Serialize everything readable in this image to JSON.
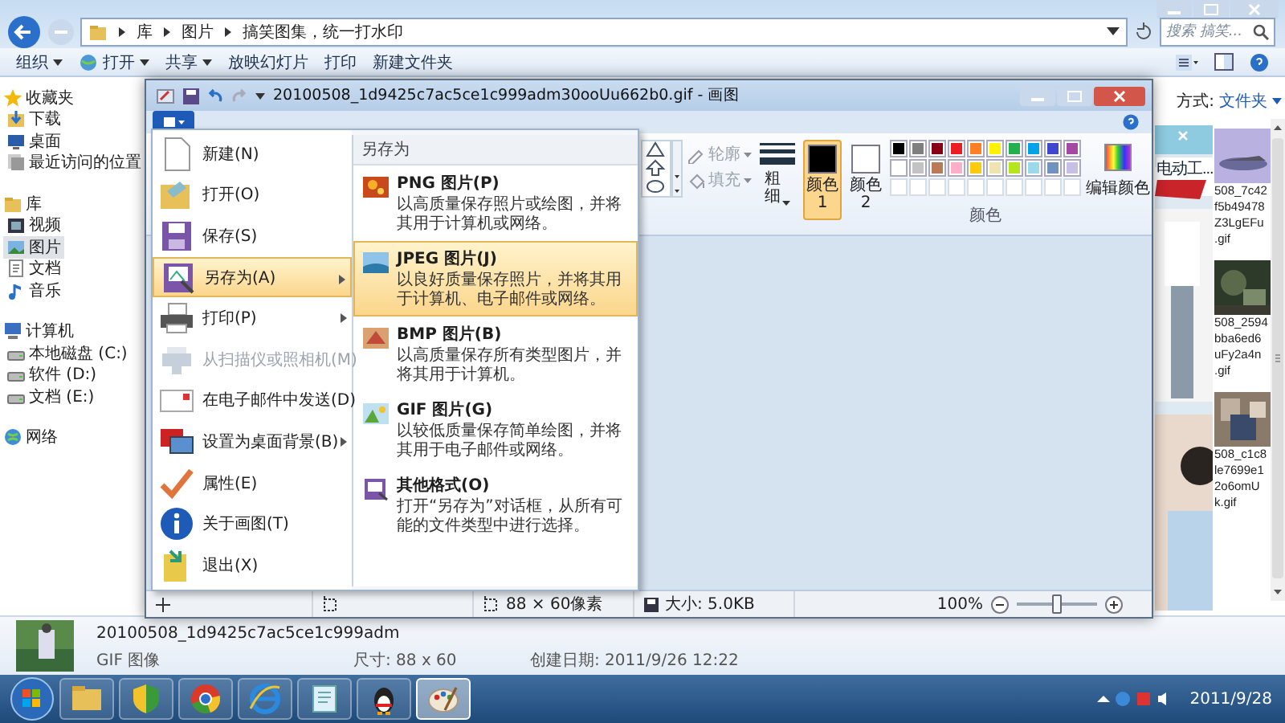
{
  "explorer": {
    "breadcrumb": [
      "库",
      "图片",
      "搞笑图集，统一打水印"
    ],
    "search": {
      "placeholder": "搜索 搞笑..."
    },
    "toolbar": [
      {
        "label": "组织",
        "dropdown": true,
        "kind": "plain"
      },
      {
        "label": "打开",
        "dropdown": true,
        "kind": "app"
      },
      {
        "label": "共享",
        "dropdown": true,
        "kind": "plain"
      },
      {
        "label": "放映幻灯片",
        "dropdown": false,
        "kind": "plain"
      },
      {
        "label": "打印",
        "dropdown": false,
        "kind": "plain"
      },
      {
        "label": "新建文件夹",
        "dropdown": false,
        "kind": "plain"
      }
    ],
    "sidebar": [
      {
        "label": "收藏夹",
        "kind": "star",
        "children": [
          {
            "label": "下载",
            "kind": "download",
            "selected": false
          },
          {
            "label": "桌面",
            "kind": "desktop",
            "selected": false
          },
          {
            "label": "最近访问的位置",
            "kind": "recent",
            "selected": false
          }
        ]
      },
      {
        "label": "库",
        "kind": "library",
        "children": [
          {
            "label": "视频",
            "kind": "video",
            "selected": false
          },
          {
            "label": "图片",
            "kind": "picture",
            "selected": true
          },
          {
            "label": "文档",
            "kind": "doc",
            "selected": false
          },
          {
            "label": "音乐",
            "kind": "music",
            "selected": false
          }
        ]
      },
      {
        "label": "计算机",
        "kind": "computer",
        "children": [
          {
            "label": "本地磁盘 (C:)",
            "kind": "drive",
            "selected": false
          },
          {
            "label": "软件 (D:)",
            "kind": "drive",
            "selected": false
          },
          {
            "label": "文档 (E:)",
            "kind": "drive",
            "selected": false
          }
        ]
      },
      {
        "label": "网络",
        "kind": "network"
      }
    ],
    "arrange": {
      "label": "方式:",
      "value": "文件夹"
    },
    "ad": {
      "text": "电动工..."
    },
    "thumbnails": [
      {
        "lines": [
          "508_7c42",
          "f5b49478",
          "Z3LgEFu",
          ".gif"
        ]
      },
      {
        "lines": [
          "508_2594",
          "bba6ed6",
          "uFy2a4n",
          ".gif"
        ]
      },
      {
        "lines": [
          "508_c1c8",
          "le7699e1",
          "2o6omU",
          "k.gif"
        ]
      }
    ],
    "details": {
      "name": "20100508_1d9425c7ac5ce1c999adm",
      "type": "GIF 图像",
      "size": "尺寸: 88 x 60",
      "created": "创建日期: 2011/9/26 12:22"
    }
  },
  "paint": {
    "title": "20100508_1d9425c7ac5ce1c999adm30ooUu662b0.gif - 画图",
    "menu": [
      {
        "label": "新建(N)",
        "kind": "new",
        "submenu": false,
        "disabled": false,
        "selected": false
      },
      {
        "label": "打开(O)",
        "kind": "open",
        "submenu": false,
        "disabled": false,
        "selected": false
      },
      {
        "label": "保存(S)",
        "kind": "save",
        "submenu": false,
        "disabled": false,
        "selected": false
      },
      {
        "label": "另存为(A)",
        "kind": "saveas",
        "submenu": true,
        "disabled": false,
        "selected": true
      },
      {
        "label": "打印(P)",
        "kind": "print",
        "submenu": true,
        "disabled": false,
        "selected": false
      },
      {
        "label": "从扫描仪或照相机(M)",
        "kind": "scanner",
        "submenu": false,
        "disabled": true,
        "selected": false
      },
      {
        "label": "在电子邮件中发送(D)",
        "kind": "email",
        "submenu": false,
        "disabled": false,
        "selected": false
      },
      {
        "label": "设置为桌面背景(B)",
        "kind": "wallpaper",
        "submenu": true,
        "disabled": false,
        "selected": false
      },
      {
        "label": "属性(E)",
        "kind": "check",
        "submenu": false,
        "disabled": false,
        "selected": false
      },
      {
        "label": "关于画图(T)",
        "kind": "info",
        "submenu": false,
        "disabled": false,
        "selected": false
      },
      {
        "label": "退出(X)",
        "kind": "exit",
        "submenu": false,
        "disabled": false,
        "selected": false
      }
    ],
    "save_as": {
      "heading": "另存为",
      "items": [
        {
          "title": "PNG 图片(P)",
          "text": "以高质量保存照片或绘图，并将其用于计算机或网络。",
          "kind": "flowers",
          "selected": false
        },
        {
          "title": "JPEG 图片(J)",
          "text": "以良好质量保存照片，并将其用于计算机、电子邮件或网络。",
          "kind": "landscape",
          "selected": true
        },
        {
          "title": "BMP 图片(B)",
          "text": "以高质量保存所有类型图片，并将其用于计算机。",
          "kind": "painting",
          "selected": false
        },
        {
          "title": "GIF 图片(G)",
          "text": "以较低质量保存简单绘图，并将其用于电子邮件或网络。",
          "kind": "drawing",
          "selected": false
        },
        {
          "title": "其他格式(O)",
          "text": "打开“另存为”对话框，从所有可能的文件类型中进行选择。",
          "kind": "other",
          "selected": false
        }
      ]
    },
    "ribbon": {
      "outline": {
        "label": "轮廓",
        "disabled": true
      },
      "fill": {
        "label": "填充",
        "disabled": true
      },
      "size": {
        "label": "粗细"
      },
      "colors": [
        {
          "label": "颜色 1",
          "color": "#000000",
          "selected": true
        },
        {
          "label": "颜色 2",
          "color": "#ffffff",
          "selected": false
        }
      ],
      "palette": [
        {
          "color": "#000000"
        },
        {
          "color": "#7f7f7f"
        },
        {
          "color": "#880015"
        },
        {
          "color": "#ed1c24"
        },
        {
          "color": "#ff7f27"
        },
        {
          "color": "#fff200"
        },
        {
          "color": "#22b14c"
        },
        {
          "color": "#00a2e8"
        },
        {
          "color": "#3f48cc"
        },
        {
          "color": "#a349a4"
        },
        {
          "color": "#ffffff"
        },
        {
          "color": "#c3c3c3"
        },
        {
          "color": "#b97a57"
        },
        {
          "color": "#ffaec9"
        },
        {
          "color": "#ffc90e"
        },
        {
          "color": "#efe4b0"
        },
        {
          "color": "#b5e61d"
        },
        {
          "color": "#99d9ea"
        },
        {
          "color": "#7092be"
        },
        {
          "color": "#c8bfe7"
        }
      ],
      "edit_colors": "编辑颜色",
      "group_label": "颜色"
    },
    "status": {
      "dimensions": "88 × 60像素",
      "size": "大小: 5.0KB",
      "zoom": "100%",
      "level": 0.5
    }
  },
  "taskbar": {
    "apps": [
      {
        "kind": "folder",
        "selected": false
      },
      {
        "kind": "shield",
        "selected": false
      },
      {
        "kind": "chrome",
        "selected": false
      },
      {
        "kind": "ie",
        "selected": false
      },
      {
        "kind": "notepad",
        "selected": false
      },
      {
        "kind": "qq",
        "selected": false
      },
      {
        "kind": "paint",
        "selected": true
      }
    ],
    "date": "2011/9/28"
  }
}
